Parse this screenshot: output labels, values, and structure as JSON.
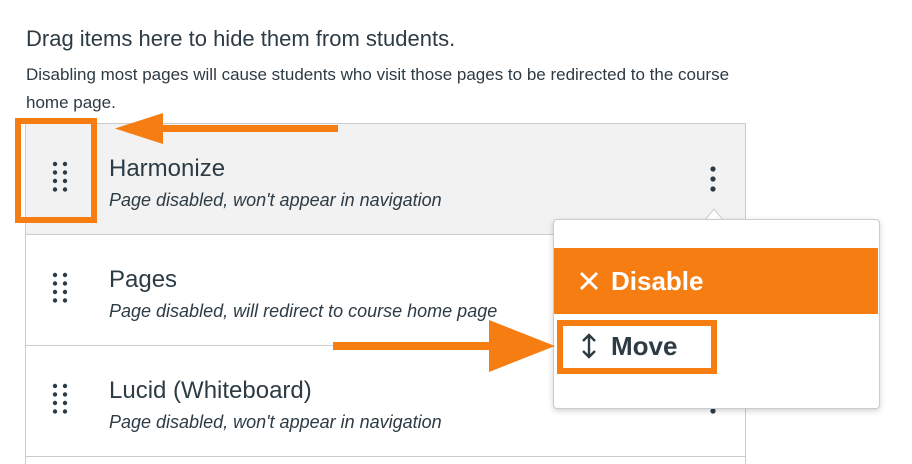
{
  "header": {
    "title": "Drag items here to hide them from students.",
    "description": "Disabling most pages will cause students who visit those pages to be redirected to the course home page."
  },
  "items": [
    {
      "name": "Harmonize",
      "status": "Page disabled, won't appear in navigation"
    },
    {
      "name": "Pages",
      "status": "Page disabled, will redirect to course home page"
    },
    {
      "name": "Lucid (Whiteboard)",
      "status": "Page disabled, won't appear in navigation"
    }
  ],
  "menu": {
    "disable_label": "Disable",
    "move_label": "Move"
  },
  "colors": {
    "accent": "#f57d12",
    "text": "#2d3b45",
    "border": "#c7cdd1",
    "row_highlight": "#f2f2f2"
  },
  "icons": [
    "drag-handle-icon",
    "kebab-menu-icon",
    "close-icon",
    "move-arrows-icon",
    "annotation-arrow"
  ]
}
